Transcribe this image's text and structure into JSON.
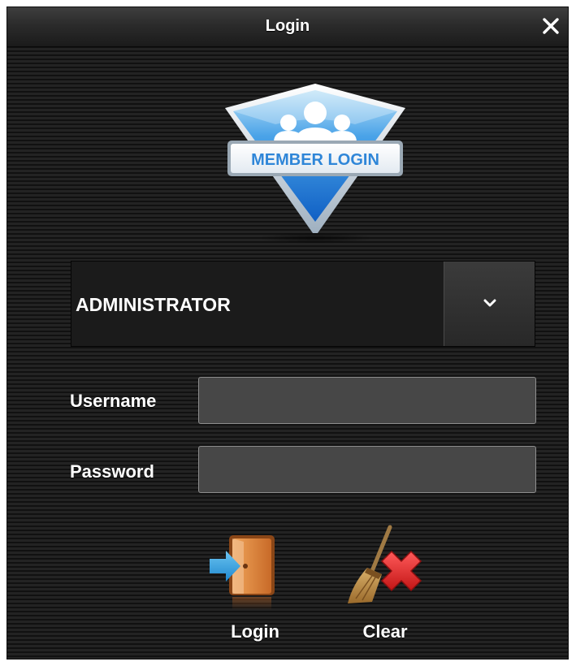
{
  "window": {
    "title": "Login"
  },
  "logo": {
    "text": "MEMBER LOGIN",
    "icon": "member-login-shield"
  },
  "role_select": {
    "value": "ADMINISTRATOR"
  },
  "form": {
    "username_label": "Username",
    "username_value": "",
    "password_label": "Password",
    "password_value": ""
  },
  "actions": {
    "login_label": "Login",
    "login_icon": "door-enter-icon",
    "clear_label": "Clear",
    "clear_icon": "broom-clear-icon"
  },
  "colors": {
    "background": "#1c1c1c",
    "field_background": "#474747",
    "text": "#ffffff",
    "logo_blue": "#2f86d8"
  }
}
